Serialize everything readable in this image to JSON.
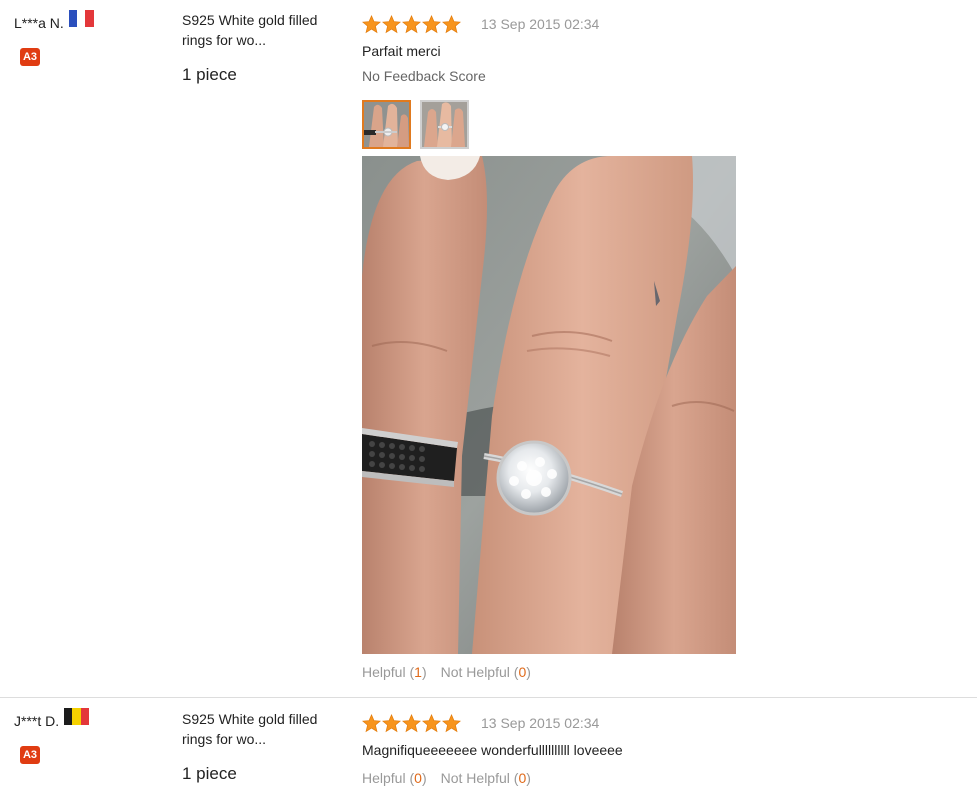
{
  "theme": {
    "star_color": "#f7941d",
    "badge_color": "#e03c12",
    "count_color": "#e06a1a",
    "active_thumb_border": "#e07a1f"
  },
  "reviews": [
    {
      "buyer_name": "L***a N.",
      "country_flag": "flag-france",
      "flag_colors": [
        "#2b4fbd",
        "#ffffff",
        "#e3373a"
      ],
      "level": "A3",
      "product_title": "S925 White gold filled rings for wo...",
      "quantity": "1 piece",
      "stars": 5,
      "date": "13 Sep 2015 02:34",
      "text": "Parfait merci",
      "feedback_score": "No Feedback Score",
      "photos": [
        "ring-photo-1",
        "ring-photo-2"
      ],
      "helpful_label": "Helpful",
      "helpful_count": "1",
      "not_helpful_label": "Not Helpful",
      "not_helpful_count": "0"
    },
    {
      "buyer_name": "J***t D.",
      "country_flag": "flag-belgium",
      "flag_colors": [
        "#1c1c1c",
        "#f5d100",
        "#e3373a"
      ],
      "level": "A3",
      "product_title": "S925 White gold filled rings for wo...",
      "quantity": "1 piece",
      "stars": 5,
      "date": "13 Sep 2015 02:34",
      "text": "Magnifiqueeeeeee wonderfullllllllll loveeee",
      "helpful_label": "Helpful",
      "helpful_count": "0",
      "not_helpful_label": "Not Helpful",
      "not_helpful_count": "0"
    }
  ]
}
